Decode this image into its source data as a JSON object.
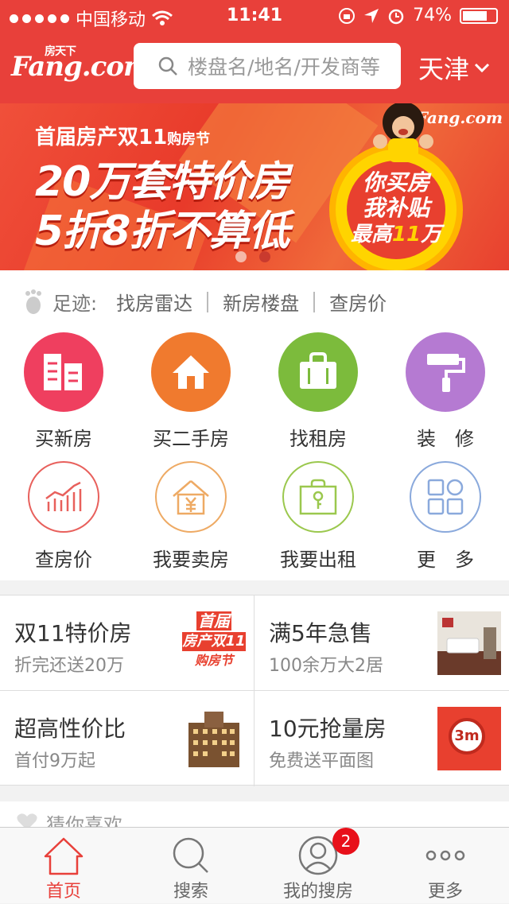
{
  "status_bar": {
    "carrier": "中国移动",
    "time": "11:41",
    "battery": "74%"
  },
  "header": {
    "logo": "Fang.com",
    "logo_small": "房天下",
    "search_placeholder": "楼盘名/地名/开发商等",
    "city": "天津"
  },
  "banner": {
    "subtitle": "首届房产双11",
    "subtitle_small": "购房节",
    "line1": "20万套特价房",
    "line2": "5折8折不算低",
    "badge_line1": "你买房",
    "badge_line2": "我补贴",
    "badge_line3_a": "最高",
    "badge_line3_b": "11",
    "badge_line3_c": "万",
    "logo": "Fang.com",
    "pages": 2,
    "active_page": 1
  },
  "footprint": {
    "label": "足迹:",
    "links": [
      "找房雷达",
      "新房楼盘",
      "查房价"
    ]
  },
  "grid": [
    {
      "label": "买新房",
      "color": "#ef3f5f"
    },
    {
      "label": "买二手房",
      "color": "#f07a2e"
    },
    {
      "label": "找租房",
      "color": "#7cbb3c"
    },
    {
      "label": "装　修",
      "color": "#b57ad2"
    },
    {
      "label": "查房价",
      "color": "#e8605c"
    },
    {
      "label": "我要卖房",
      "color": "#eeaa64"
    },
    {
      "label": "我要出租",
      "color": "#9bc84e"
    },
    {
      "label": "更　多",
      "color": "#8aa9dc"
    }
  ],
  "promos": [
    {
      "title": "双11特价房",
      "subtitle": "折完还送20万",
      "img_text_1": "首届",
      "img_text_2": "房产双11",
      "img_text_3": "购房节"
    },
    {
      "title": "满5年急售",
      "subtitle": "100余万大2居"
    },
    {
      "title": "超高性价比",
      "subtitle": "首付9万起"
    },
    {
      "title": "10元抢量房",
      "subtitle": "免费送平面图",
      "img_text_1": "3m"
    }
  ],
  "guess": {
    "label": "猜你喜欢"
  },
  "tabbar": [
    {
      "label": "首页",
      "active": true
    },
    {
      "label": "搜索",
      "active": false
    },
    {
      "label": "我的搜房",
      "active": false,
      "badge": "2"
    },
    {
      "label": "更多",
      "active": false
    }
  ]
}
